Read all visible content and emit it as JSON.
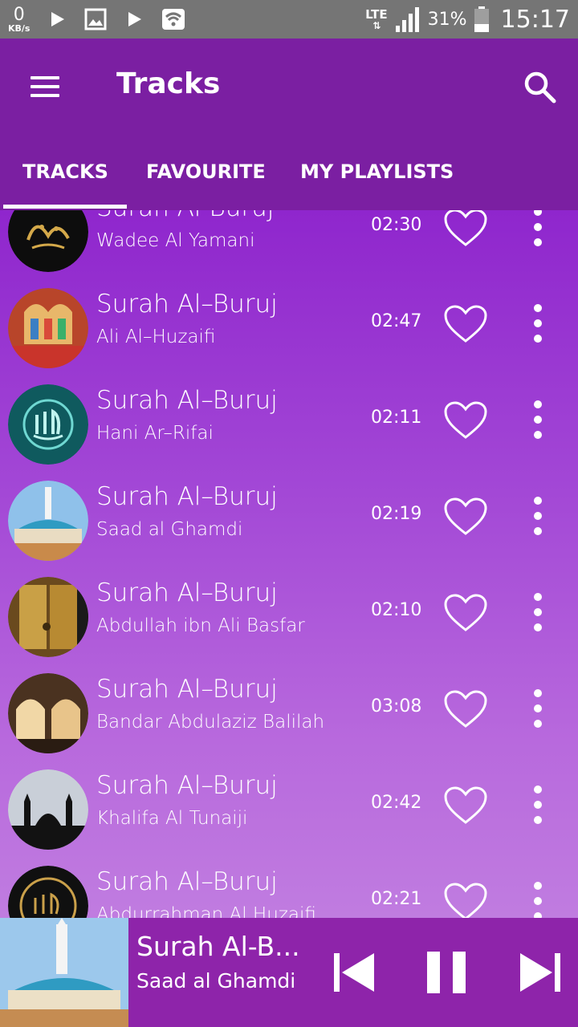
{
  "status_bar": {
    "net_speed": "0",
    "net_unit": "KB/s",
    "network": "LTE",
    "battery": "31%",
    "time": "15:17",
    "icons": [
      "play-icon",
      "image-icon",
      "play-icon",
      "wifi-icon",
      "signal-icon",
      "battery-icon"
    ]
  },
  "app_bar": {
    "title": "Tracks",
    "menu_icon": "hamburger-menu-icon",
    "search_icon": "search-icon"
  },
  "tabs": [
    {
      "label": "TRACKS",
      "active": true
    },
    {
      "label": "FAVOURITE",
      "active": false
    },
    {
      "label": "MY PLAYLISTS",
      "active": false
    }
  ],
  "tracks": [
    {
      "title": "Surah Al-Buruj",
      "artist": "Wadee Al Yamani",
      "duration": "02:30",
      "thumb": "calligraphy-gold",
      "favourite": false
    },
    {
      "title": "Surah Al–Buruj",
      "artist": "Ali Al–Huzaifi",
      "duration": "02:47",
      "thumb": "mosque-stained-glass",
      "favourite": false
    },
    {
      "title": "Surah Al–Buruj",
      "artist": "Hani Ar–Rifai",
      "duration": "02:11",
      "thumb": "calligraphy-teal",
      "favourite": false
    },
    {
      "title": "Surah Al–Buruj",
      "artist": "Saad al Ghamdi",
      "duration": "02:19",
      "thumb": "mosque-blue-dome",
      "favourite": false
    },
    {
      "title": "Surah Al–Buruj",
      "artist": "Abdullah ibn Ali Basfar",
      "duration": "02:10",
      "thumb": "kaaba-door",
      "favourite": false
    },
    {
      "title": "Surah Al–Buruj",
      "artist": "Bandar Abdulaziz Balilah",
      "duration": "03:08",
      "thumb": "mosque-arches",
      "favourite": false
    },
    {
      "title": "Surah Al–Buruj",
      "artist": "Khalifa Al Tunaiji",
      "duration": "02:42",
      "thumb": "mosque-silhouette",
      "favourite": false
    },
    {
      "title": "Surah Al–Buruj",
      "artist": "Abdurrahman Al Huzaifi",
      "duration": "02:21",
      "thumb": "calligraphy-black-gold",
      "favourite": false
    }
  ],
  "player": {
    "title": "Surah Al-B...",
    "artist": "Saad al Ghamdi",
    "thumb": "mosque-blue-dome"
  }
}
